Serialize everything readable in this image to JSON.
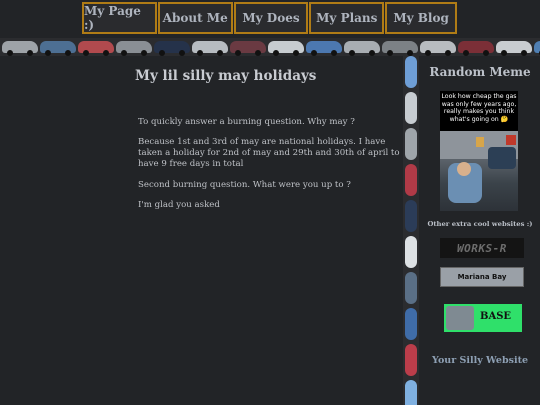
{
  "nav": {
    "items": [
      {
        "label": "My Page :)"
      },
      {
        "label": "About Me"
      },
      {
        "label": "My Does"
      },
      {
        "label": "My Plans"
      },
      {
        "label": "My Blog"
      }
    ]
  },
  "article": {
    "title": "My lil silly may holidays",
    "paragraphs": [
      "To quickly answer a burning question. Why may ?",
      "Because 1st and 3rd of may are national holidays. I have taken a holiday for 2nd of may and 29th and 30th of april to have 9 free days in total",
      "Second burning question. What were you up to ?",
      "I'm glad you asked"
    ]
  },
  "sidebar": {
    "title": "Random Meme",
    "meme_caption": "Look how cheap the gas was only few years ago, really makes you think what's going on 🤔",
    "extra_heading": "Other extra cool websites :)",
    "badges": {
      "works": "WORKS-R",
      "mariana": "Mariana Bay",
      "base": "BASE"
    },
    "footer_link": "Your Silly Website"
  },
  "colors": {
    "background": "#222427",
    "nav_border": "#b07c16",
    "base_badge": "#2fe06a"
  }
}
